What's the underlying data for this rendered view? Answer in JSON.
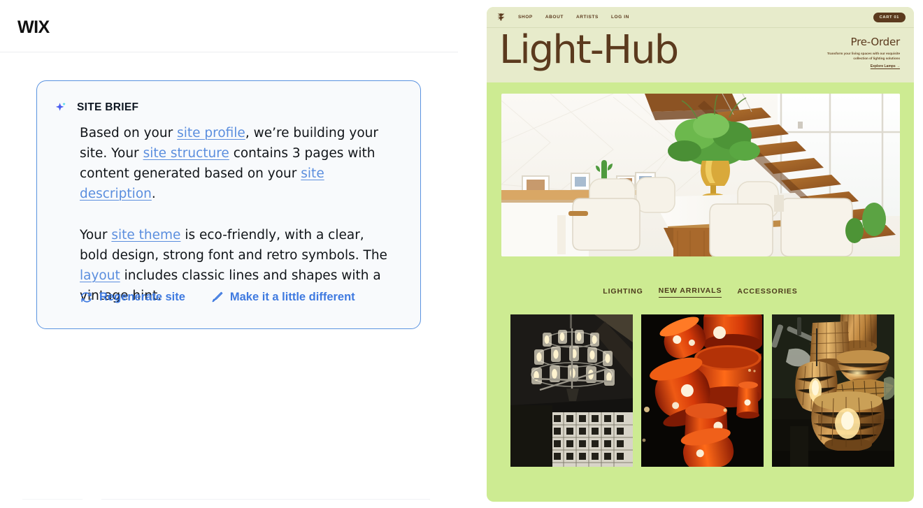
{
  "app": {
    "logo_text": "WIX"
  },
  "brief": {
    "icon": "sparkle-icon",
    "title": "SITE BRIEF",
    "paragraph1": {
      "t1": "Based on your ",
      "link1": "site profile",
      "t2": ", we’re building your site. Your ",
      "link2": "site structure",
      "t3": " contains 3 pages with content generated based on your ",
      "link3": "site description",
      "t4": "."
    },
    "paragraph2": {
      "t1": "Your ",
      "link1": "site theme",
      "t2": " is eco-friendly, with a clear, bold design, strong font and retro symbols. The ",
      "link2": "layout",
      "t3": " includes classic lines and shapes with a vintage hint."
    },
    "actions": [
      {
        "icon": "refresh-icon",
        "label": "Regenerate site"
      },
      {
        "icon": "paintbrush-icon",
        "label": "Make it a little different"
      }
    ],
    "colors": {
      "border": "#5a93e0",
      "background": "#f8fafc",
      "link": "#5b8ede",
      "action": "#3f7ae0"
    }
  },
  "preview": {
    "colors": {
      "page_background": "#cdeb92",
      "header_background": "#e7ebcb",
      "brown": "#5b3a1e"
    },
    "header": {
      "logo": "brand-mark-icon",
      "nav": [
        "SHOP",
        "ABOUT",
        "ARTISTS",
        "LOG IN"
      ],
      "cart_label": "CART 01"
    },
    "hero": {
      "title": "Light-Hub",
      "kicker": "Pre-Order",
      "description": "Transform your living spaces with our exquisite collection of lighting solutions",
      "cta": "Explore Lamps  →",
      "photo_alt": "bright-dining-room-photo"
    },
    "category_tabs": [
      {
        "label": "LIGHTING",
        "active": false
      },
      {
        "label": "NEW ARRIVALS",
        "active": true
      },
      {
        "label": "ACCESSORIES",
        "active": false
      }
    ],
    "products": [
      {
        "alt": "dark-chandelier-photo"
      },
      {
        "alt": "red-pendant-lamps-photo"
      },
      {
        "alt": "rattan-pendant-lamps-photo"
      }
    ]
  }
}
